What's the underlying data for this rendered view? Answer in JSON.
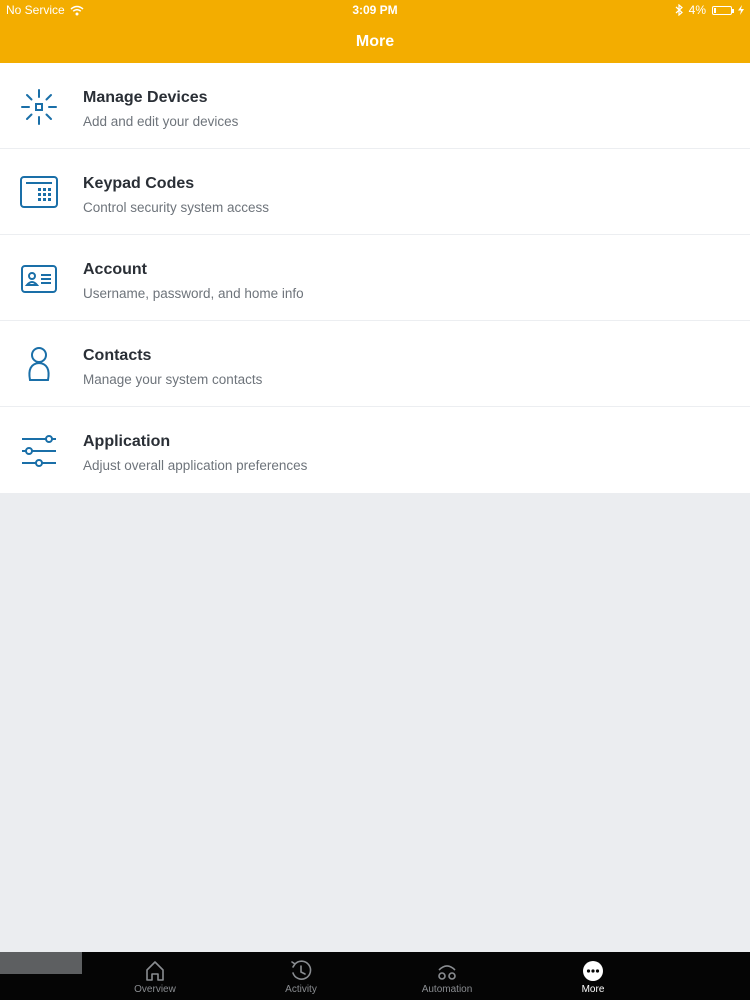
{
  "status_bar": {
    "carrier": "No Service",
    "time": "3:09 PM",
    "battery": "4%"
  },
  "nav": {
    "title": "More"
  },
  "menu": {
    "items": [
      {
        "title": "Manage Devices",
        "subtitle": "Add and edit your devices",
        "icon": "devices-icon"
      },
      {
        "title": "Keypad Codes",
        "subtitle": "Control security system access",
        "icon": "keypad-icon"
      },
      {
        "title": "Account",
        "subtitle": "Username, password, and home info",
        "icon": "account-card-icon"
      },
      {
        "title": "Contacts",
        "subtitle": "Manage your system contacts",
        "icon": "contacts-icon"
      },
      {
        "title": "Application",
        "subtitle": "Adjust overall application preferences",
        "icon": "sliders-icon"
      }
    ]
  },
  "tabbar": {
    "tabs": [
      {
        "label": "Overview",
        "icon": "home-icon"
      },
      {
        "label": "Activity",
        "icon": "history-icon"
      },
      {
        "label": "Automation",
        "icon": "automation-icon"
      },
      {
        "label": "More",
        "icon": "more-icon",
        "active": true
      }
    ]
  },
  "colors": {
    "header": "#f3ad00",
    "icon": "#1a6fa8",
    "background": "#ebedf0",
    "tabbar": "#050505"
  }
}
